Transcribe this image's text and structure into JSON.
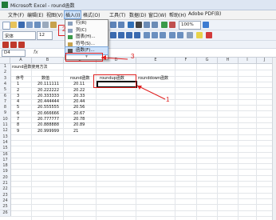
{
  "window": {
    "title": "Microsoft Excel - round函数"
  },
  "menubar": {
    "items": [
      "文件(F)",
      "编辑(E)",
      "视图(V)",
      "插入(I)",
      "格式(O)",
      "工具(T)",
      "数据(D)",
      "窗口(W)",
      "帮助(H)",
      "Adobe PDF(B)"
    ]
  },
  "toolbar": {
    "font_name": "宋体",
    "font_size": "12",
    "zoom": "100%"
  },
  "formula_bar": {
    "name_box": "D4",
    "fx": "fx"
  },
  "insert_menu": {
    "items": [
      {
        "label": "行(R)",
        "icon": "rows-icon"
      },
      {
        "label": "列(C)",
        "icon": "columns-icon"
      },
      {
        "label": "图表(H)...",
        "icon": "chart-icon"
      },
      {
        "label": "符号(S)...",
        "icon": "symbol-icon"
      },
      {
        "label": "函数(F)...",
        "icon": "function-icon",
        "highlighted": true
      }
    ],
    "more": "¥"
  },
  "sheet": {
    "columns": [
      "A",
      "B",
      "C",
      "D",
      "E",
      "F",
      "G",
      "H",
      "I",
      "J"
    ],
    "rows": [
      "1",
      "2",
      "3",
      "4",
      "5",
      "6",
      "7",
      "8",
      "9",
      "10",
      "11",
      "12",
      "13",
      "14",
      "15",
      "16",
      "17",
      "18",
      "19",
      "20",
      "21",
      "22",
      "23",
      "24",
      "25",
      "26"
    ],
    "title_cell": "round函数使用方法",
    "headers": {
      "seq": "序号",
      "value": "数值",
      "round": "round函数",
      "roundup": "roundup函数",
      "rounddown": "rounddown函数"
    },
    "data": [
      {
        "seq": "1",
        "value": "20.111111",
        "round": "20.11"
      },
      {
        "seq": "2",
        "value": "20.222222",
        "round": "20.22"
      },
      {
        "seq": "3",
        "value": "20.333333",
        "round": "20.33"
      },
      {
        "seq": "4",
        "value": "20.444444",
        "round": "20.44"
      },
      {
        "seq": "5",
        "value": "20.555555",
        "round": "20.56"
      },
      {
        "seq": "6",
        "value": "20.666666",
        "round": "20.67"
      },
      {
        "seq": "7",
        "value": "20.777777",
        "round": "20.78"
      },
      {
        "seq": "8",
        "value": "20.888888",
        "round": "20.89"
      },
      {
        "seq": "9",
        "value": "20.999999",
        "round": "21"
      }
    ]
  },
  "annotations": {
    "label1": "1",
    "label2": "2",
    "label3": "3",
    "color": "#e02020"
  }
}
